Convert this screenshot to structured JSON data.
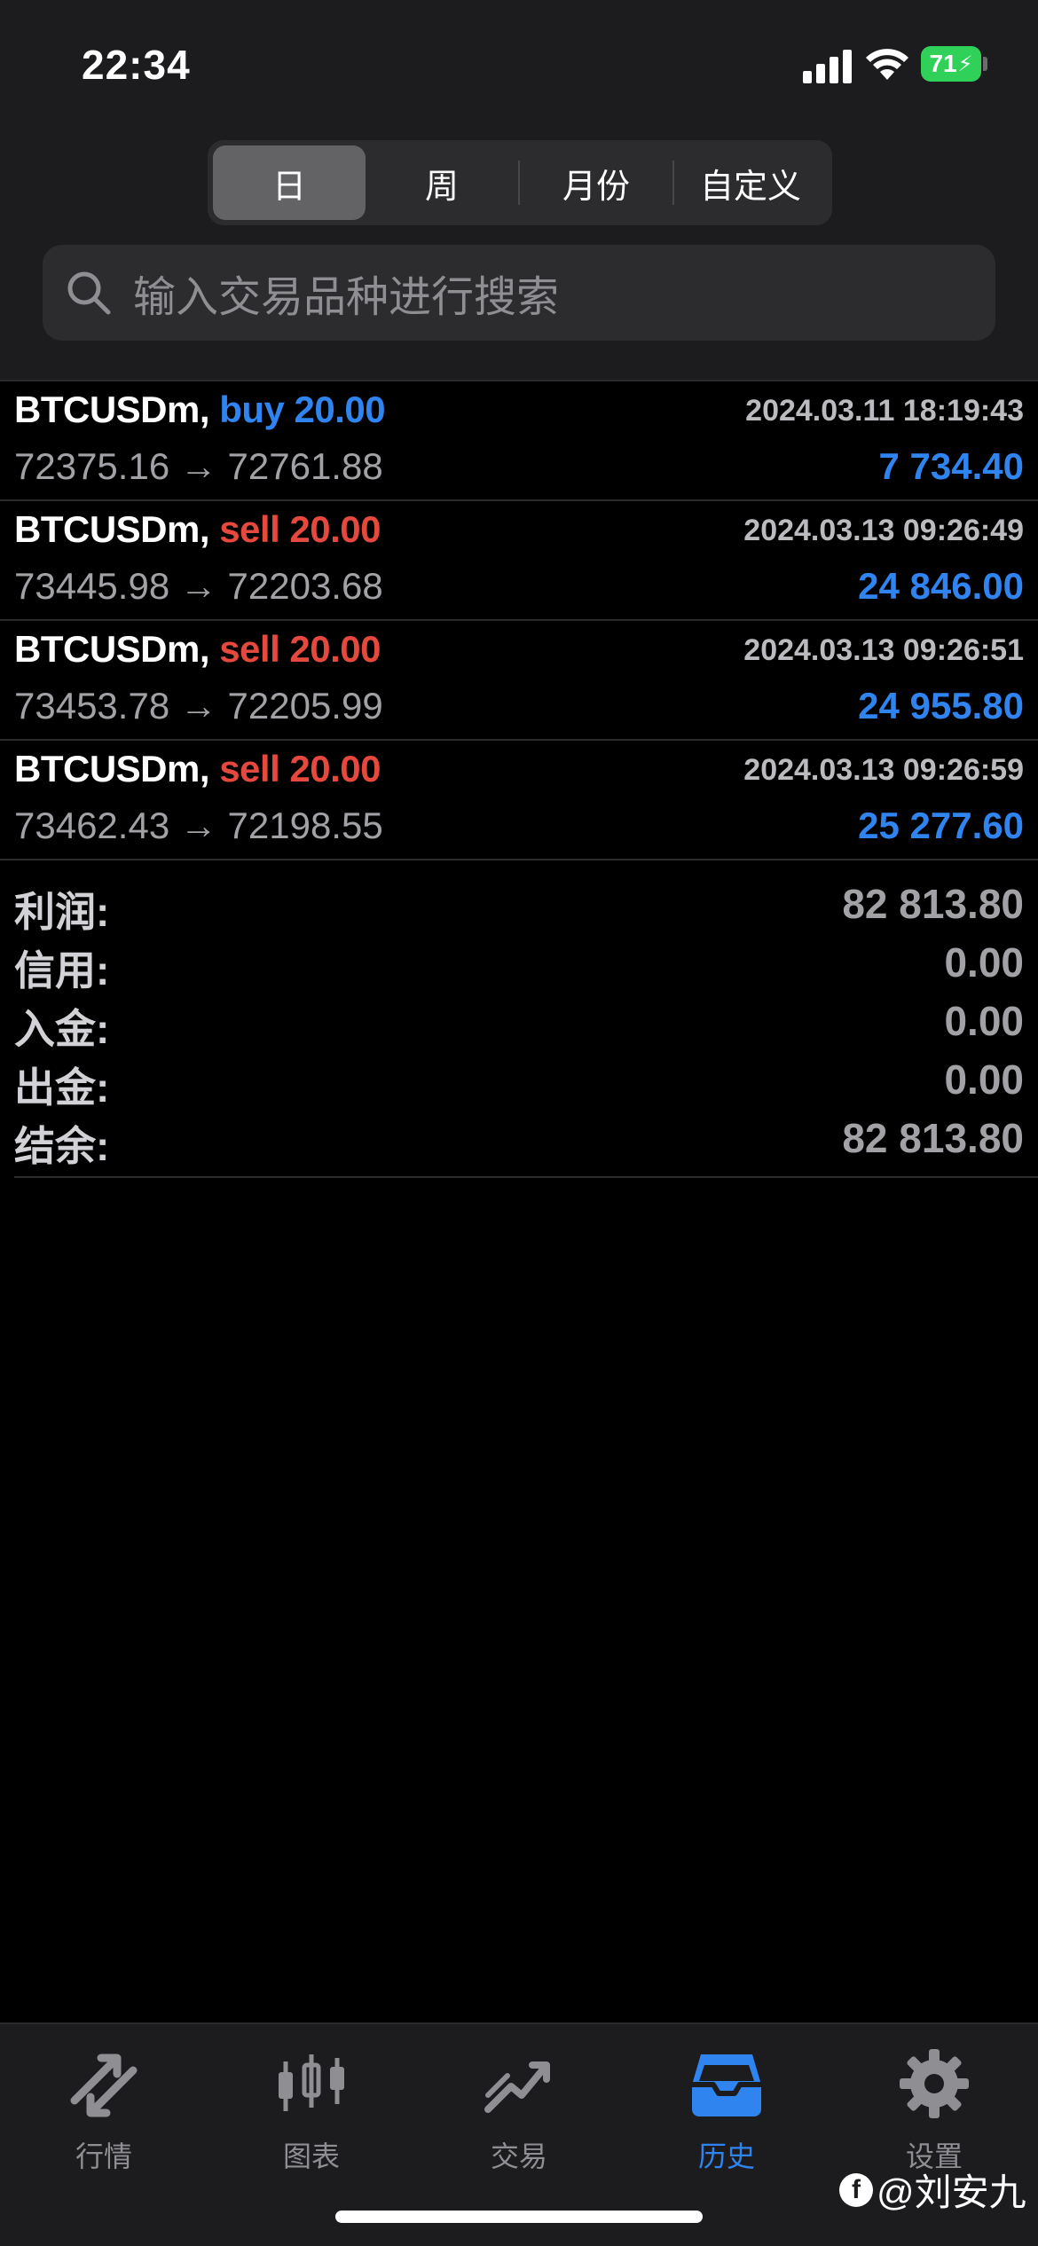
{
  "status_bar": {
    "time": "22:34",
    "battery": "71"
  },
  "period_tabs": [
    {
      "label": "日",
      "active": true
    },
    {
      "label": "周",
      "active": false
    },
    {
      "label": "月份",
      "active": false
    },
    {
      "label": "自定义",
      "active": false
    }
  ],
  "search": {
    "placeholder": "输入交易品种进行搜索",
    "icon": "search-icon"
  },
  "deals": [
    {
      "symbol": "BTCUSDm,",
      "side": "buy",
      "volume": "20.00",
      "timestamp": "2024.03.11 18:19:43",
      "prices": "72375.16 → 72761.88",
      "profit": "7 734.40"
    },
    {
      "symbol": "BTCUSDm,",
      "side": "sell",
      "volume": "20.00",
      "timestamp": "2024.03.13 09:26:49",
      "prices": "73445.98 → 72203.68",
      "profit": "24 846.00"
    },
    {
      "symbol": "BTCUSDm,",
      "side": "sell",
      "volume": "20.00",
      "timestamp": "2024.03.13 09:26:51",
      "prices": "73453.78 → 72205.99",
      "profit": "24 955.80"
    },
    {
      "symbol": "BTCUSDm,",
      "side": "sell",
      "volume": "20.00",
      "timestamp": "2024.03.13 09:26:59",
      "prices": "73462.43 → 72198.55",
      "profit": "25 277.60"
    }
  ],
  "summary": {
    "profit": {
      "label": "利润:",
      "value": "82 813.80"
    },
    "credit": {
      "label": "信用:",
      "value": "0.00"
    },
    "deposit": {
      "label": "入金:",
      "value": "0.00"
    },
    "withdrawal": {
      "label": "出金:",
      "value": "0.00"
    },
    "balance": {
      "label": "结余:",
      "value": "82 813.80"
    }
  },
  "tabbar": [
    {
      "label": "行情",
      "icon": "quotes-arrows-icon",
      "active": false
    },
    {
      "label": "图表",
      "icon": "candlestick-chart-icon",
      "active": false
    },
    {
      "label": "交易",
      "icon": "trade-trend-icon",
      "active": false
    },
    {
      "label": "历史",
      "icon": "history-inbox-icon",
      "active": true
    },
    {
      "label": "设置",
      "icon": "gear-icon",
      "active": false
    }
  ],
  "watermark": {
    "text": "@刘安九"
  },
  "colors": {
    "buy": "#2f84f0",
    "sell": "#e5483c",
    "accent": "#2f84f0",
    "battery": "#30d158"
  }
}
